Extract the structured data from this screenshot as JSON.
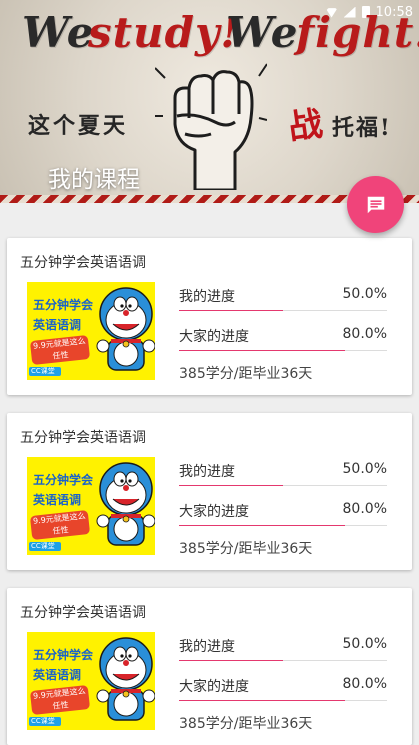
{
  "statusbar": {
    "time": "10:58"
  },
  "banner": {
    "slogan_words": [
      "We",
      "study!",
      "We",
      "fight!"
    ],
    "sub_left": "这个夏天",
    "sub_zhan": "战",
    "sub_right": "托福!"
  },
  "page": {
    "title": "我的课程"
  },
  "colors": {
    "accent": "#e4386e",
    "fab": "#f0447a"
  },
  "fab": {
    "icon": "message-icon"
  },
  "courses": [
    {
      "title": "五分钟学会英语语调",
      "thumb": {
        "line1": "五分钟学会",
        "line2": "英语语调",
        "promo": "9.9元就是这么任性",
        "badge": "CC课堂"
      },
      "my_progress_label": "我的进度",
      "my_progress_value": "50.0%",
      "my_progress": 0.5,
      "all_progress_label": "大家的进度",
      "all_progress_value": "80.0%",
      "all_progress": 0.8,
      "credits": "385学分/距毕业36天"
    },
    {
      "title": "五分钟学会英语语调",
      "thumb": {
        "line1": "五分钟学会",
        "line2": "英语语调",
        "promo": "9.9元就是这么任性",
        "badge": "CC课堂"
      },
      "my_progress_label": "我的进度",
      "my_progress_value": "50.0%",
      "my_progress": 0.5,
      "all_progress_label": "大家的进度",
      "all_progress_value": "80.0%",
      "all_progress": 0.8,
      "credits": "385学分/距毕业36天"
    },
    {
      "title": "五分钟学会英语语调",
      "thumb": {
        "line1": "五分钟学会",
        "line2": "英语语调",
        "promo": "9.9元就是这么任性",
        "badge": "CC课堂"
      },
      "my_progress_label": "我的进度",
      "my_progress_value": "50.0%",
      "my_progress": 0.5,
      "all_progress_label": "大家的进度",
      "all_progress_value": "80.0%",
      "all_progress": 0.8,
      "credits": "385学分/距毕业36天"
    }
  ]
}
